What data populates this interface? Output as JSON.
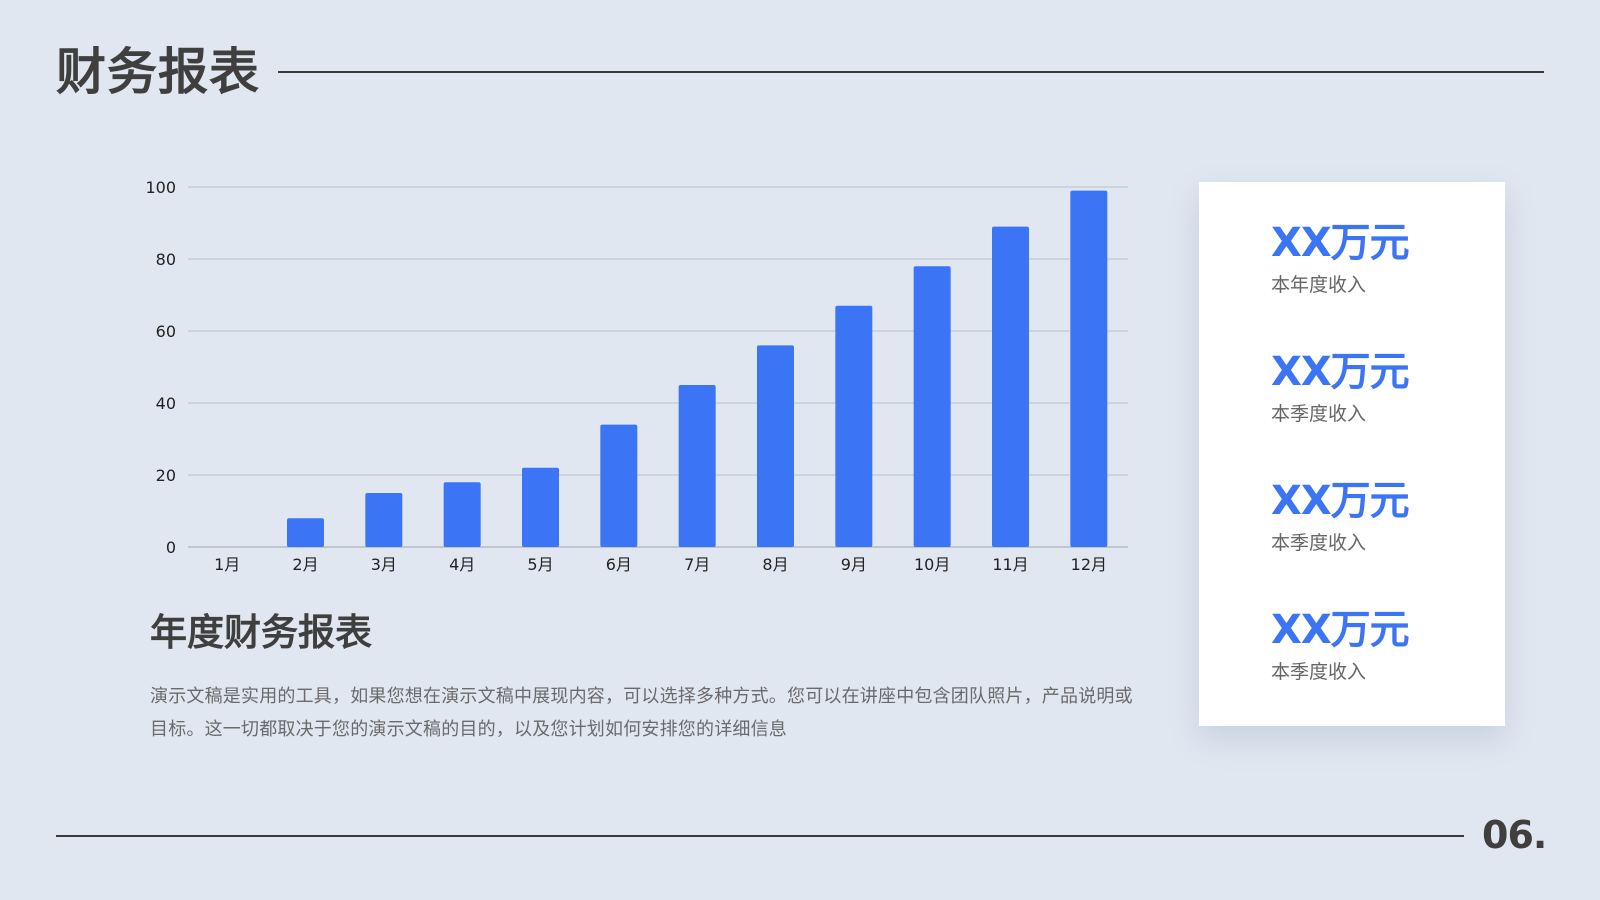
{
  "header": {
    "title": "财务报表"
  },
  "chart_data": {
    "type": "bar",
    "categories": [
      "1月",
      "2月",
      "3月",
      "4月",
      "5月",
      "6月",
      "7月",
      "8月",
      "9月",
      "10月",
      "11月",
      "12月"
    ],
    "values": [
      0,
      8,
      15,
      18,
      22,
      34,
      45,
      56,
      67,
      78,
      89,
      99
    ],
    "ylim": [
      0,
      100
    ],
    "yticks": [
      0,
      20,
      40,
      60,
      80,
      100
    ],
    "grid": true,
    "bar_color": "#3b74f5",
    "grid_color": "#b8c0cc"
  },
  "section": {
    "heading": "年度财务报表",
    "body": "演示文稿是实用的工具，如果您想在演示文稿中展现内容，可以选择多种方式。您可以在讲座中包含团队照片，产品说明或目标。这一切都取决于您的演示文稿的目的，以及您计划如何安排您的详细信息"
  },
  "stats": [
    {
      "value": "XX万元",
      "label": "本年度收入"
    },
    {
      "value": "XX万元",
      "label": "本季度收入"
    },
    {
      "value": "XX万元",
      "label": "本季度收入"
    },
    {
      "value": "XX万元",
      "label": "本季度收入"
    }
  ],
  "footer": {
    "page_number": "06."
  },
  "colors": {
    "background": "#e1e7f1",
    "accent": "#3b74f5",
    "text_dark": "#3f3f3f",
    "text_muted": "#6a6a6a"
  }
}
